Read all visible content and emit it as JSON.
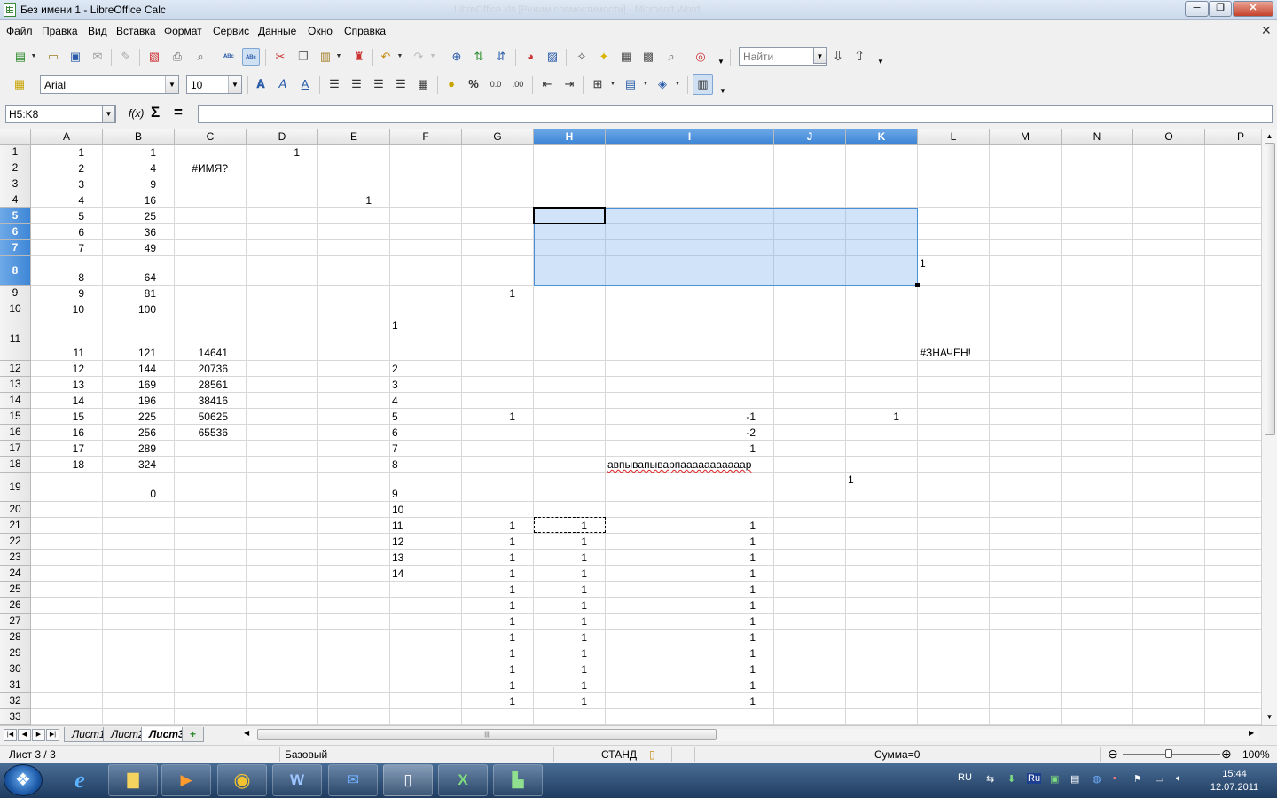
{
  "window": {
    "title": "Без имени 1 - LibreOffice Calc",
    "ghost_title": "LibreOffice.xls [Режим совместимости] - Microsoft Word",
    "minimize_glyph": "─",
    "maximize_glyph": "❐",
    "close_glyph": "✕"
  },
  "menu": {
    "items": [
      "Файл",
      "Правка",
      "Вид",
      "Вставка",
      "Формат",
      "Сервис",
      "Данные",
      "Окно",
      "Справка"
    ],
    "close_doc_glyph": "✕"
  },
  "toolbar_standard": {
    "icons": [
      "new-icon",
      "open-icon",
      "save-icon",
      "email-icon",
      "edit-file-icon",
      "export-pdf-icon",
      "print-icon",
      "print-preview-icon",
      "spellcheck-icon",
      "autospellcheck-icon",
      "cut-icon",
      "copy-icon",
      "paste-icon",
      "clone-format-icon",
      "undo-icon",
      "redo-icon",
      "hyperlink-icon",
      "sort-asc-icon",
      "sort-desc-icon",
      "insert-chart-icon",
      "insert-pivot-icon",
      "navigator-icon",
      "gallery-icon",
      "datasources-icon",
      "styles-icon",
      "zoom-icon",
      "help-icon"
    ],
    "find_placeholder": "Найти"
  },
  "toolbar_format": {
    "font_name": "Arial",
    "font_size": "10",
    "icons": [
      "styles-icon",
      "bold-icon",
      "italic-icon",
      "underline-icon",
      "align-left-icon",
      "align-center-icon",
      "align-right-icon",
      "justify-icon",
      "merge-cells-icon",
      "currency-icon",
      "percent-icon",
      "number-format-icon",
      "add-decimal-icon",
      "decrease-indent-icon",
      "increase-indent-icon",
      "borders-icon",
      "line-style-icon",
      "bg-color-icon",
      "grid-lines-icon"
    ],
    "percent_glyph": "%"
  },
  "formula_bar": {
    "name_box": "H5:K8",
    "fx_glyph": "f(x)",
    "sum_glyph": "Σ",
    "equals_glyph": "=",
    "formula": ""
  },
  "grid": {
    "columns": [
      "A",
      "B",
      "C",
      "D",
      "E",
      "F",
      "G",
      "H",
      "I",
      "J",
      "K",
      "L",
      "M",
      "N",
      "O",
      "P"
    ],
    "selected_columns": [
      "H",
      "I",
      "J",
      "K"
    ],
    "rows": [
      "1",
      "2",
      "3",
      "4",
      "5",
      "6",
      "7",
      "8",
      "9",
      "10",
      "11",
      "12",
      "13",
      "14",
      "15",
      "16",
      "17",
      "18",
      "19",
      "20",
      "21",
      "22",
      "23",
      "24",
      "25",
      "26",
      "27",
      "28",
      "29",
      "30",
      "31",
      "32",
      "33"
    ],
    "selected_rows": [
      "5",
      "6",
      "7",
      "8"
    ],
    "selection": "H5:K8",
    "active_cell": "H5",
    "copy_range": "H21",
    "cells": [
      {
        "ref": "A1",
        "text": "1",
        "align": "right"
      },
      {
        "ref": "B1",
        "text": "1",
        "align": "right"
      },
      {
        "ref": "D1",
        "text": "1",
        "align": "right"
      },
      {
        "ref": "A2",
        "text": "2",
        "align": "right"
      },
      {
        "ref": "B2",
        "text": "4",
        "align": "right"
      },
      {
        "ref": "C2",
        "text": "#ИМЯ?",
        "align": "right"
      },
      {
        "ref": "A3",
        "text": "3",
        "align": "right"
      },
      {
        "ref": "B3",
        "text": "9",
        "align": "right"
      },
      {
        "ref": "A4",
        "text": "4",
        "align": "right"
      },
      {
        "ref": "B4",
        "text": "16",
        "align": "right"
      },
      {
        "ref": "E4",
        "text": "1",
        "align": "right"
      },
      {
        "ref": "A5",
        "text": "5",
        "align": "right"
      },
      {
        "ref": "B5",
        "text": "25",
        "align": "right"
      },
      {
        "ref": "A6",
        "text": "6",
        "align": "right"
      },
      {
        "ref": "B6",
        "text": "36",
        "align": "right"
      },
      {
        "ref": "A7",
        "text": "7",
        "align": "right"
      },
      {
        "ref": "B7",
        "text": "49",
        "align": "right"
      },
      {
        "ref": "A8",
        "text": "8",
        "align": "right"
      },
      {
        "ref": "B8",
        "text": "64",
        "align": "right"
      },
      {
        "ref": "L8",
        "text": "1",
        "align": "left-middle"
      },
      {
        "ref": "A9",
        "text": "9",
        "align": "right"
      },
      {
        "ref": "B9",
        "text": "81",
        "align": "right"
      },
      {
        "ref": "G9",
        "text": "1",
        "align": "right"
      },
      {
        "ref": "A10",
        "text": "10",
        "align": "right"
      },
      {
        "ref": "B10",
        "text": "100",
        "align": "right"
      },
      {
        "ref": "A11",
        "text": "11",
        "align": "right"
      },
      {
        "ref": "B11",
        "text": "121",
        "align": "right"
      },
      {
        "ref": "C11",
        "text": "14641",
        "align": "right"
      },
      {
        "ref": "F11",
        "text": "1",
        "align": "left-top"
      },
      {
        "ref": "L11",
        "text": "#ЗНАЧЕН!",
        "align": "right"
      },
      {
        "ref": "A12",
        "text": "12",
        "align": "right"
      },
      {
        "ref": "B12",
        "text": "144",
        "align": "right"
      },
      {
        "ref": "C12",
        "text": "20736",
        "align": "right"
      },
      {
        "ref": "F12",
        "text": "2",
        "align": "left"
      },
      {
        "ref": "A13",
        "text": "13",
        "align": "right"
      },
      {
        "ref": "B13",
        "text": "169",
        "align": "right"
      },
      {
        "ref": "C13",
        "text": "28561",
        "align": "right"
      },
      {
        "ref": "F13",
        "text": "3",
        "align": "left"
      },
      {
        "ref": "A14",
        "text": "14",
        "align": "right"
      },
      {
        "ref": "B14",
        "text": "196",
        "align": "right"
      },
      {
        "ref": "C14",
        "text": "38416",
        "align": "right"
      },
      {
        "ref": "F14",
        "text": "4",
        "align": "left"
      },
      {
        "ref": "A15",
        "text": "15",
        "align": "right"
      },
      {
        "ref": "B15",
        "text": "225",
        "align": "right"
      },
      {
        "ref": "C15",
        "text": "50625",
        "align": "right"
      },
      {
        "ref": "F15",
        "text": "5",
        "align": "left"
      },
      {
        "ref": "G15",
        "text": "1",
        "align": "right"
      },
      {
        "ref": "I15",
        "text": "-1",
        "align": "right"
      },
      {
        "ref": "K15",
        "text": "1",
        "align": "right"
      },
      {
        "ref": "A16",
        "text": "16",
        "align": "right"
      },
      {
        "ref": "B16",
        "text": "256",
        "align": "right"
      },
      {
        "ref": "C16",
        "text": "65536",
        "align": "right"
      },
      {
        "ref": "F16",
        "text": "6",
        "align": "left"
      },
      {
        "ref": "I16",
        "text": "-2",
        "align": "right"
      },
      {
        "ref": "A17",
        "text": "17",
        "align": "right"
      },
      {
        "ref": "B17",
        "text": "289",
        "align": "right"
      },
      {
        "ref": "F17",
        "text": "7",
        "align": "left"
      },
      {
        "ref": "I17",
        "text": "1",
        "align": "right"
      },
      {
        "ref": "A18",
        "text": "18",
        "align": "right"
      },
      {
        "ref": "B18",
        "text": "324",
        "align": "right"
      },
      {
        "ref": "F18",
        "text": "8",
        "align": "left"
      },
      {
        "ref": "I18",
        "text": "авпывапыварпааааааааааар",
        "align": "left",
        "misspelled": true
      },
      {
        "ref": "B19",
        "text": "0",
        "align": "right"
      },
      {
        "ref": "F19",
        "text": "9",
        "align": "left"
      },
      {
        "ref": "K19",
        "text": "1",
        "align": "left-middle"
      },
      {
        "ref": "F20",
        "text": "10",
        "align": "left"
      },
      {
        "ref": "F21",
        "text": "11",
        "align": "left"
      },
      {
        "ref": "G21",
        "text": "1",
        "align": "right"
      },
      {
        "ref": "H21",
        "text": "1",
        "align": "right"
      },
      {
        "ref": "I21",
        "text": "1",
        "align": "right"
      },
      {
        "ref": "F22",
        "text": "12",
        "align": "left"
      },
      {
        "ref": "G22",
        "text": "1",
        "align": "right"
      },
      {
        "ref": "H22",
        "text": "1",
        "align": "right"
      },
      {
        "ref": "I22",
        "text": "1",
        "align": "right"
      },
      {
        "ref": "F23",
        "text": "13",
        "align": "left"
      },
      {
        "ref": "G23",
        "text": "1",
        "align": "right"
      },
      {
        "ref": "H23",
        "text": "1",
        "align": "right"
      },
      {
        "ref": "I23",
        "text": "1",
        "align": "right"
      },
      {
        "ref": "F24",
        "text": "14",
        "align": "left"
      },
      {
        "ref": "G24",
        "text": "1",
        "align": "right"
      },
      {
        "ref": "H24",
        "text": "1",
        "align": "right"
      },
      {
        "ref": "I24",
        "text": "1",
        "align": "right"
      },
      {
        "ref": "G25",
        "text": "1",
        "align": "right"
      },
      {
        "ref": "H25",
        "text": "1",
        "align": "right"
      },
      {
        "ref": "I25",
        "text": "1",
        "align": "right"
      },
      {
        "ref": "G26",
        "text": "1",
        "align": "right"
      },
      {
        "ref": "H26",
        "text": "1",
        "align": "right"
      },
      {
        "ref": "I26",
        "text": "1",
        "align": "right"
      },
      {
        "ref": "G27",
        "text": "1",
        "align": "right"
      },
      {
        "ref": "H27",
        "text": "1",
        "align": "right"
      },
      {
        "ref": "I27",
        "text": "1",
        "align": "right"
      },
      {
        "ref": "G28",
        "text": "1",
        "align": "right"
      },
      {
        "ref": "H28",
        "text": "1",
        "align": "right"
      },
      {
        "ref": "I28",
        "text": "1",
        "align": "right"
      },
      {
        "ref": "G29",
        "text": "1",
        "align": "right"
      },
      {
        "ref": "H29",
        "text": "1",
        "align": "right"
      },
      {
        "ref": "I29",
        "text": "1",
        "align": "right"
      },
      {
        "ref": "G30",
        "text": "1",
        "align": "right"
      },
      {
        "ref": "H30",
        "text": "1",
        "align": "right"
      },
      {
        "ref": "I30",
        "text": "1",
        "align": "right"
      },
      {
        "ref": "G31",
        "text": "1",
        "align": "right"
      },
      {
        "ref": "H31",
        "text": "1",
        "align": "right"
      },
      {
        "ref": "I31",
        "text": "1",
        "align": "right"
      },
      {
        "ref": "G32",
        "text": "1",
        "align": "right"
      },
      {
        "ref": "H32",
        "text": "1",
        "align": "right"
      },
      {
        "ref": "I32",
        "text": "1",
        "align": "right"
      }
    ]
  },
  "sheets": {
    "tabs": [
      "Лист1",
      "Лист2",
      "Лист3"
    ],
    "active": "Лист3",
    "add_glyph": "+"
  },
  "status": {
    "sheet_info": "Лист 3 / 3",
    "page_style": "Базовый",
    "mode": "СТАНД",
    "sum": "Сумма=0",
    "zoom_out_glyph": "⊖",
    "zoom_in_glyph": "⊕",
    "zoom": "100%"
  },
  "taskbar": {
    "start_glyph": "❖",
    "apps": [
      "ie-icon",
      "explorer-icon",
      "media-player-icon",
      "chrome-icon",
      "word-icon",
      "thunderbird-icon",
      "calc-document-icon",
      "excel-icon",
      "libreoffice-icon"
    ],
    "lang": "RU",
    "tray_lang_badge": "Ru",
    "time": "15:44",
    "date": "12.07.2011"
  }
}
